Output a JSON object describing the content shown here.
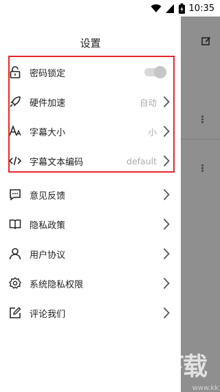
{
  "status": {
    "time": "10:35"
  },
  "drawer": {
    "title": "设置",
    "items": [
      {
        "label": "密码锁定",
        "icon": "lock-icon",
        "value": "",
        "control": "toggle"
      },
      {
        "label": "硬件加速",
        "icon": "rocket-icon",
        "value": "自动",
        "control": "chevron"
      },
      {
        "label": "字幕大小",
        "icon": "font-size-icon",
        "value": "小",
        "control": "chevron"
      },
      {
        "label": "字幕文本编码",
        "icon": "code-icon",
        "value": "default",
        "control": "chevron"
      },
      {
        "label": "意见反馈",
        "icon": "feedback-icon",
        "value": "",
        "control": "chevron"
      },
      {
        "label": "隐私政策",
        "icon": "book-icon",
        "value": "",
        "control": "chevron"
      },
      {
        "label": "用户协议",
        "icon": "user-icon",
        "value": "",
        "control": "chevron"
      },
      {
        "label": "系统隐私权限",
        "icon": "gear-icon",
        "value": "",
        "control": "chevron"
      },
      {
        "label": "评论我们",
        "icon": "edit-icon",
        "value": "",
        "control": "chevron"
      }
    ]
  },
  "watermark": {
    "brand": "KK下载",
    "url": "www.kk"
  },
  "colors": {
    "highlight_box": "#e8252b",
    "accent": "#222222"
  }
}
